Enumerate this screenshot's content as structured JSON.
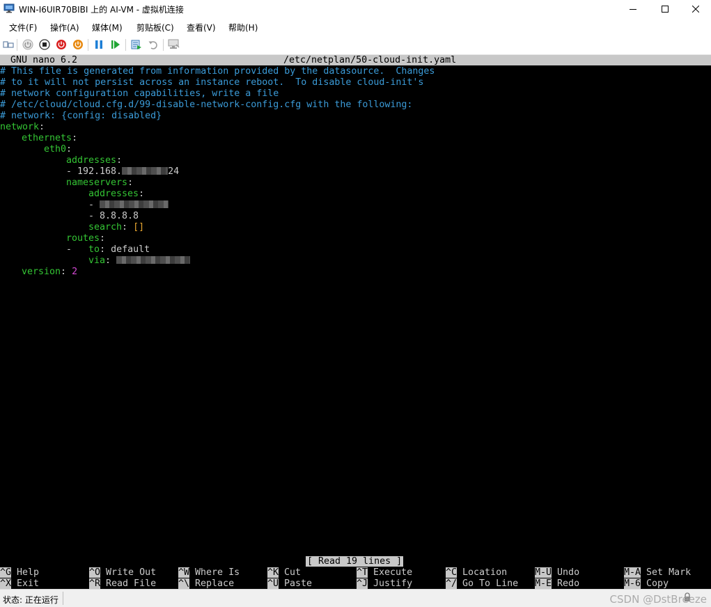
{
  "window": {
    "title": "WIN-I6UIR70BIBI 上的 AI-VM - 虚拟机连接"
  },
  "menu": {
    "items": [
      {
        "label": "文件(F)"
      },
      {
        "label": "操作(A)"
      },
      {
        "label": "媒体(M)"
      },
      {
        "label": "剪贴板(C)"
      },
      {
        "label": "查看(V)"
      },
      {
        "label": "帮助(H)"
      }
    ]
  },
  "toolbar": {
    "icons": [
      "ctrl-alt-del-icon",
      "start-icon",
      "turn-off-icon",
      "shutdown-icon",
      "power-icon",
      "pause-icon",
      "resume-icon",
      "checkpoint-icon",
      "revert-icon",
      "enhanced-session-icon"
    ]
  },
  "nano": {
    "version": "GNU nano 6.2",
    "filename": "/etc/netplan/50-cloud-init.yaml",
    "lines": {
      "c1": "# This file is generated from information provided by the datasource.  Changes",
      "c2": "# to it will not persist across an instance reboot.  To disable cloud-init's",
      "c3": "# network configuration capabilities, write a file",
      "c4": "# /etc/cloud/cloud.cfg.d/99-disable-network-config.cfg with the following:",
      "c5": "# network: {config: disabled}",
      "network": "network",
      "ethernets": "ethernets",
      "eth0": "eth0",
      "addresses": "addresses",
      "address_prefix": "- 192.168.",
      "address_suffix": "24",
      "nameservers": "nameservers",
      "ns_addresses": "addresses",
      "dns_dash": "-",
      "dns2": "- 8.8.8.8",
      "search": "search",
      "search_value": "[]",
      "routes": "routes",
      "route_dash": "-",
      "route_to": "to",
      "route_to_value": "default",
      "route_via": "via",
      "version": "version",
      "version_value": "2",
      "colon": ":"
    },
    "status_message": "[ Read 19 lines ]",
    "shortcuts": [
      {
        "key": "^G",
        "label": "Help"
      },
      {
        "key": "^O",
        "label": "Write Out"
      },
      {
        "key": "^W",
        "label": "Where Is"
      },
      {
        "key": "^K",
        "label": "Cut"
      },
      {
        "key": "^T",
        "label": "Execute"
      },
      {
        "key": "^C",
        "label": "Location"
      },
      {
        "key": "M-U",
        "label": "Undo"
      },
      {
        "key": "M-A",
        "label": "Set Mark"
      },
      {
        "key": "^X",
        "label": "Exit"
      },
      {
        "key": "^R",
        "label": "Read File"
      },
      {
        "key": "^\\",
        "label": "Replace"
      },
      {
        "key": "^U",
        "label": "Paste"
      },
      {
        "key": "^J",
        "label": "Justify"
      },
      {
        "key": "^/",
        "label": "Go To Line"
      },
      {
        "key": "M-E",
        "label": "Redo"
      },
      {
        "key": "M-6",
        "label": "Copy"
      }
    ]
  },
  "statusbar": {
    "status": "状态: 正在运行",
    "watermark": "CSDN @DstBreeze"
  },
  "colors": {
    "comment": "#3b9bd8",
    "key": "#34c534",
    "number": "#d44ad4",
    "bracket": "#e8a630"
  }
}
